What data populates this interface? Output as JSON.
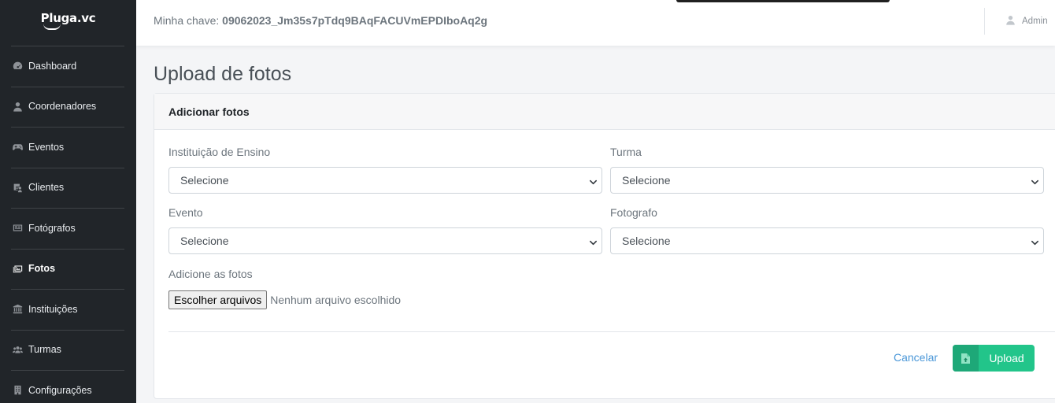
{
  "brand": {
    "name": "Pluga.vc"
  },
  "sidebar": {
    "items": [
      {
        "label": "Dashboard",
        "icon": "dashboard-icon"
      },
      {
        "label": "Coordenadores",
        "icon": "user-icon"
      },
      {
        "label": "Eventos",
        "icon": "gamepad-icon"
      },
      {
        "label": "Clientes",
        "icon": "clients-icon"
      },
      {
        "label": "Fotógrafos",
        "icon": "photographer-icon"
      },
      {
        "label": "Fotos",
        "icon": "photos-icon",
        "active": true
      },
      {
        "label": "Instituições",
        "icon": "institution-icon"
      },
      {
        "label": "Turmas",
        "icon": "users-icon"
      },
      {
        "label": "Configurações",
        "icon": "settings-icon"
      }
    ]
  },
  "topbar": {
    "key_label": "Minha chave:",
    "key_value": "09062023_Jm35s7pTdq9BAqFACUVmEPDIboAq2g",
    "user_label": "Admin"
  },
  "page": {
    "title": "Upload de fotos"
  },
  "card": {
    "title": "Adicionar fotos",
    "fields": {
      "instituicao": {
        "label": "Instituição de Ensino",
        "value": "Selecione"
      },
      "turma": {
        "label": "Turma",
        "value": "Selecione"
      },
      "evento": {
        "label": "Evento",
        "value": "Selecione"
      },
      "fotografo": {
        "label": "Fotografo",
        "value": "Selecione"
      }
    },
    "file": {
      "label": "Adicione as fotos",
      "button": "Escolher arquivos",
      "status": "Nenhum arquivo escolhido"
    },
    "actions": {
      "cancel": "Cancelar",
      "upload": "Upload"
    }
  },
  "colors": {
    "sidebar_bg": "#212529",
    "upload_green": "#22c58a",
    "link_blue": "#4a97d8"
  }
}
